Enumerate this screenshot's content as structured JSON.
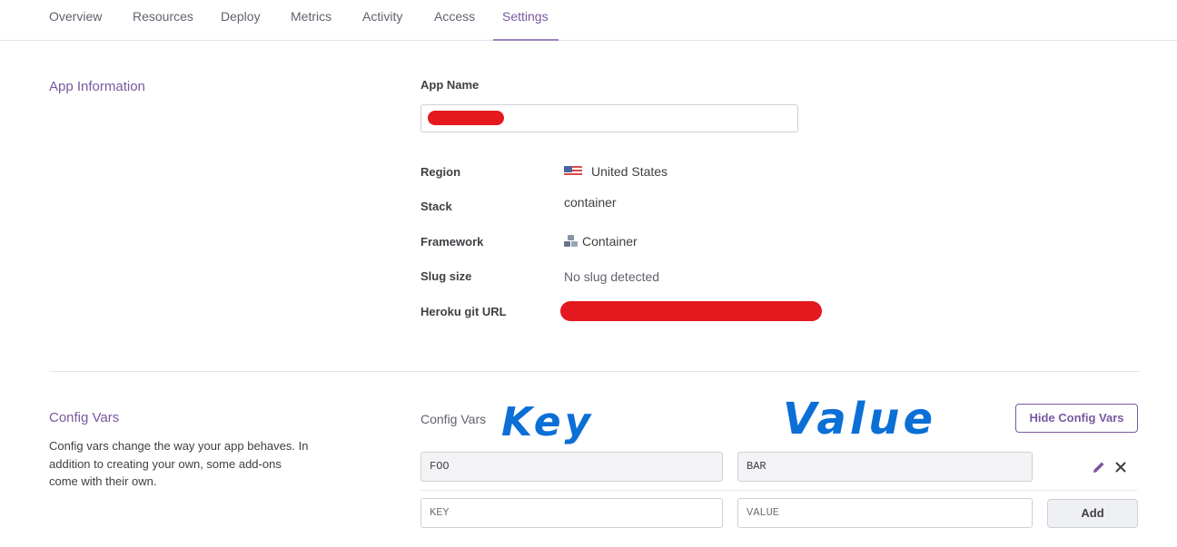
{
  "tabs": [
    {
      "label": "Overview"
    },
    {
      "label": "Resources"
    },
    {
      "label": "Deploy"
    },
    {
      "label": "Metrics"
    },
    {
      "label": "Activity"
    },
    {
      "label": "Access"
    },
    {
      "label": "Settings",
      "active": true
    }
  ],
  "app_info": {
    "section_title": "App Information",
    "app_name_label": "App Name",
    "region_label": "Region",
    "region_value": "United States",
    "region_icon": "us-flag-icon",
    "stack_label": "Stack",
    "stack_value": "container",
    "framework_label": "Framework",
    "framework_value": "Container",
    "framework_icon": "container-icon",
    "slug_label": "Slug size",
    "slug_value": "No slug detected",
    "git_label": "Heroku git URL"
  },
  "config_vars": {
    "section_title": "Config Vars",
    "description": "Config vars change the way your app behaves. In addition to creating your own, some add-ons come with their own.",
    "list_label": "Config Vars",
    "hide_button": "Hide Config Vars",
    "annotation_key": "Key",
    "annotation_value": "Value",
    "vars": [
      {
        "key": "FOO",
        "value": "BAR"
      }
    ],
    "new_key_placeholder": "KEY",
    "new_value_placeholder": "VALUE",
    "add_button": "Add"
  },
  "colors": {
    "accent": "#79589f",
    "redaction": "#e3191f",
    "annotation": "#0b6fd6"
  }
}
